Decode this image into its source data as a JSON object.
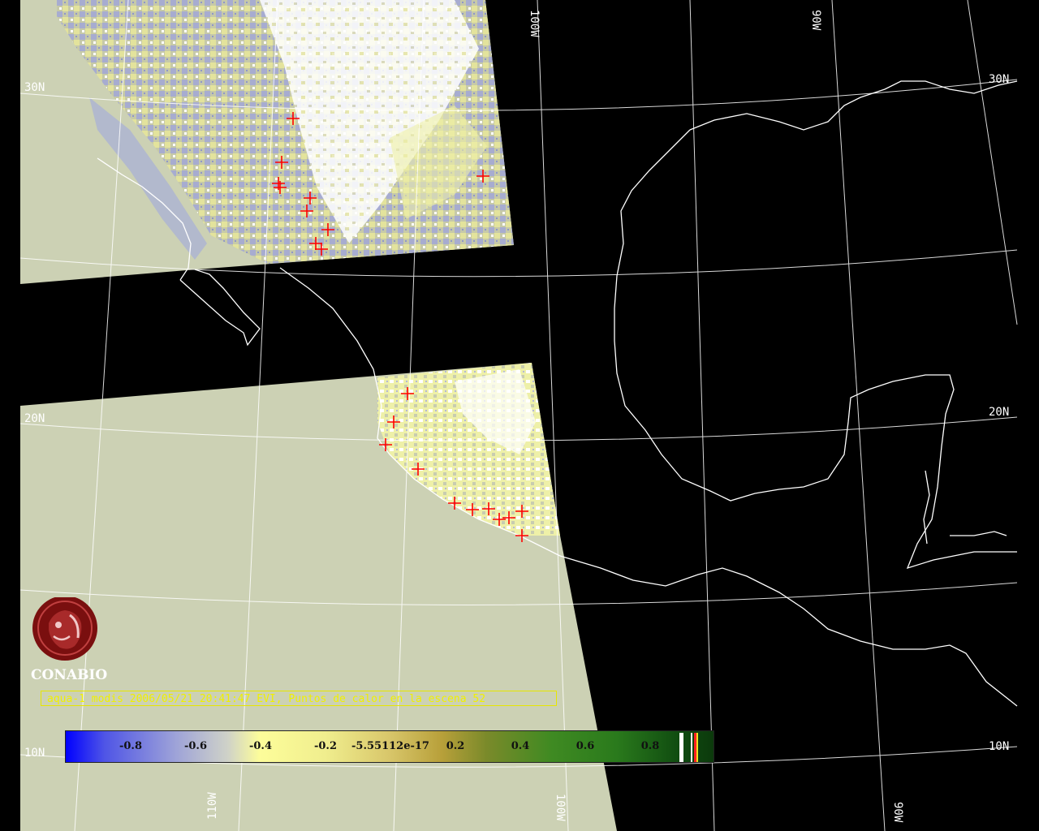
{
  "caption": {
    "text": "aqua-1 modis 2006/05/21 20:41:47 EVI, Puntos de calor en la escena 52"
  },
  "logo": {
    "label": "CONABIO",
    "icon": "conabio-logo"
  },
  "grid_labels": {
    "lat_30_left": "30N",
    "lat_30_right": "30N",
    "lat_20_left": "20N",
    "lat_20_right": "20N",
    "lat_10_left": "10N",
    "lat_10_right": "10N",
    "lon_100_top": "100W",
    "lon_90_top": "90W",
    "lon_110_bottom": "110W",
    "lon_100_bottom": "100W",
    "lon_90_bottom": "90W"
  },
  "colorbar": {
    "ticks": [
      "-0.8",
      "-0.6",
      "-0.4",
      "-0.2",
      "-5.55112e-17",
      "0.2",
      "0.4",
      "0.6",
      "0.8"
    ],
    "colors": {
      "low": "#0000ff",
      "mid_low": "#b0b4d8",
      "zero": "#fdfd9a",
      "mid_high": "#b8a03a",
      "high": "#2f8a1e",
      "top": "#0e3a0e"
    }
  },
  "colors": {
    "ocean_fill": "#ccd1b4",
    "land_dry": "#ecec9e",
    "land_veg": "#9fa7d2",
    "cloud": "#ffffff",
    "fire_marker": "#ff0000",
    "grid": "#ffffff",
    "caption_text": "#f0f000",
    "logo": "#7a0f0f"
  },
  "fire_count": 52
}
